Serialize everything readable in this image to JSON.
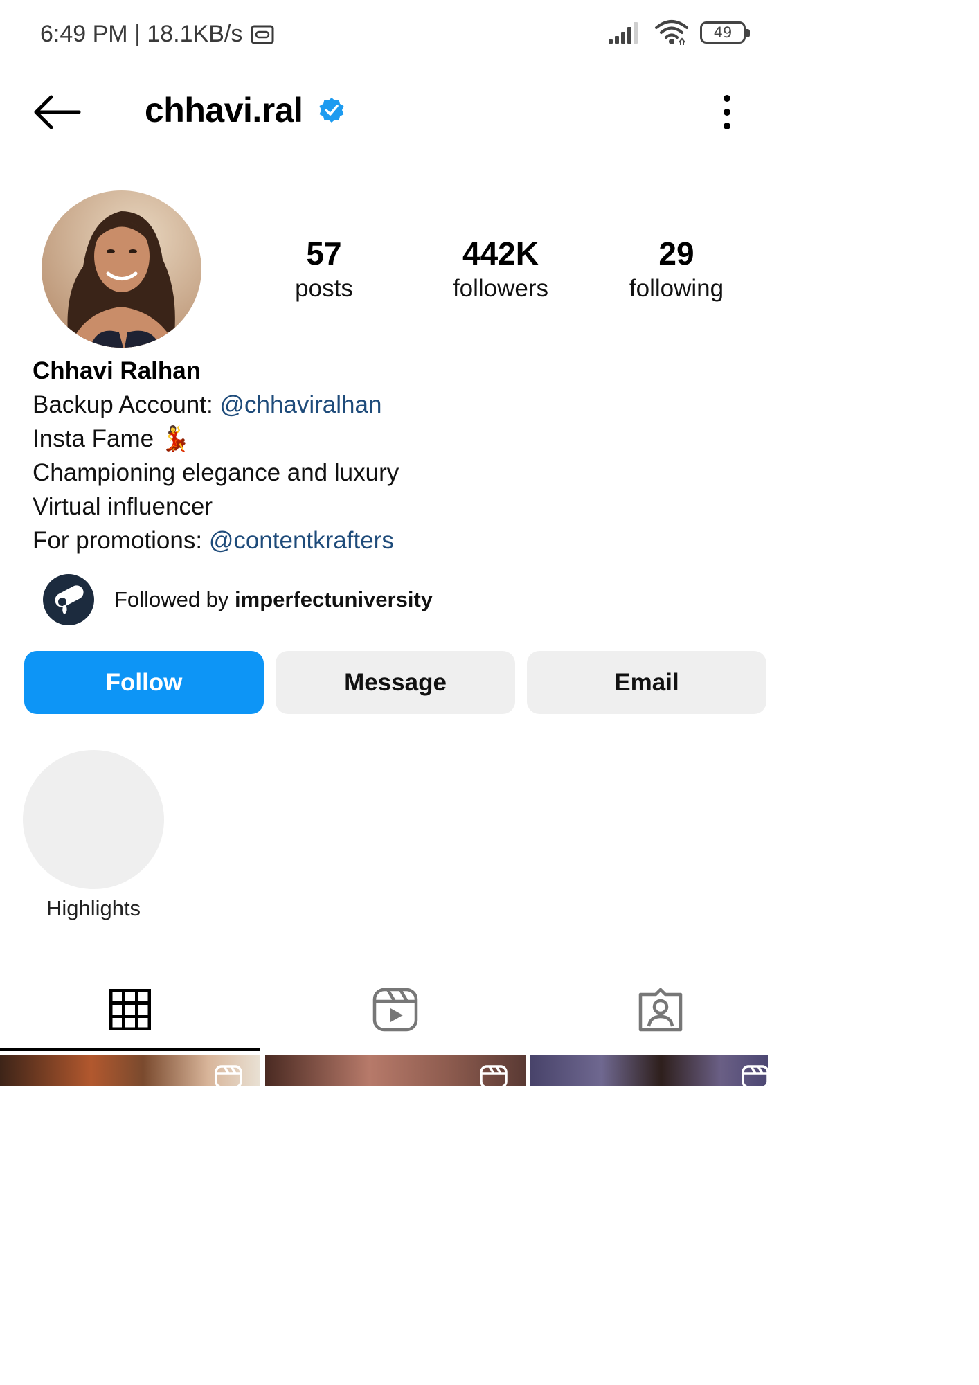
{
  "status_bar": {
    "time_speed": "6:49 PM | 18.1KB/s",
    "battery_level": "49"
  },
  "header": {
    "username": "chhavi.ral",
    "verified": true
  },
  "profile": {
    "stats": {
      "posts_count": "57",
      "posts_label": "posts",
      "followers_count": "442K",
      "followers_label": "followers",
      "following_count": "29",
      "following_label": "following"
    },
    "bio": {
      "name": "Chhavi Ralhan",
      "backup_prefix": "Backup Account: ",
      "backup_handle": "@chhaviralhan",
      "line_insta_fame": "Insta Fame 💃",
      "line_championing": "Championing elegance and luxury",
      "line_virtual": "Virtual influencer",
      "promo_prefix": "For promotions: ",
      "promo_handle": "@contentkrafters"
    },
    "followed_by": {
      "prefix": "Followed by ",
      "account": "imperfectuniversity"
    }
  },
  "actions": {
    "follow_label": "Follow",
    "message_label": "Message",
    "email_label": "Email"
  },
  "highlights": {
    "label": "Highlights"
  },
  "tabs": {
    "active": "grid",
    "items": [
      "grid-icon",
      "reels-icon",
      "tagged-icon"
    ]
  },
  "colors": {
    "accent": "#0d95f6",
    "link": "#1e4b7a",
    "verified": "#1d9bf0",
    "secondary_button": "#efefef"
  }
}
